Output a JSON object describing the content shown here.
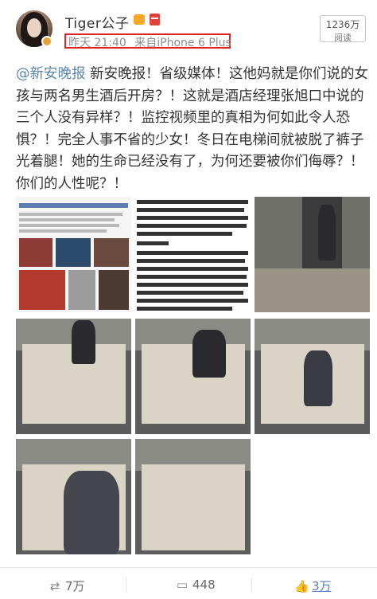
{
  "header": {
    "username": "Tiger公子",
    "time": "昨天 21:40",
    "source": "来自iPhone 6 Plus",
    "read_count": "1236万",
    "read_label": "阅读"
  },
  "post": {
    "mention": "@新安晚报",
    "body": " 新安晚报！省级媒体！这他妈就是你们说的女孩与两名男生酒后开房？！这就是酒店经理张旭口中说的三个人没有异样？！监控视频里的真相为何如此令人恐惧？！完全人事不省的少女！冬日在电梯间就被脱了裤子光着腿！她的生命已经没有了，为何还要被你们侮辱？！你们的人性呢？！"
  },
  "images": [
    {
      "name": "news-screenshot",
      "kind": "news",
      "text": "1月1日凌晨，芜湖职业技术学院学生……"
    },
    {
      "name": "news-article-text",
      "kind": "text",
      "lines": [
        "班组两个们(语：权力以后搬两个男同学",
        "喝的多。",
        "酒店报警",
        "酒店，记者找到了事发酒店的经理张旭。",
        "三个人走进宾馆房间。"
      ]
    },
    {
      "name": "cctv-elevator-1",
      "kind": "cctv"
    },
    {
      "name": "cctv-elevator-2",
      "kind": "cctv"
    },
    {
      "name": "cctv-elevator-3",
      "kind": "cctv"
    },
    {
      "name": "cctv-elevator-4",
      "kind": "cctv"
    },
    {
      "name": "cctv-elevator-5",
      "kind": "cctv"
    },
    {
      "name": "cctv-elevator-6",
      "kind": "cctv"
    },
    {
      "name": "cctv-elevator-7",
      "kind": "cctv"
    }
  ],
  "footer": {
    "repost": "7万",
    "comment": "448",
    "like": "3万"
  },
  "colors": {
    "link": "#5a86ac",
    "highlight_border": "#e02424",
    "badge": "#e9a23b"
  }
}
